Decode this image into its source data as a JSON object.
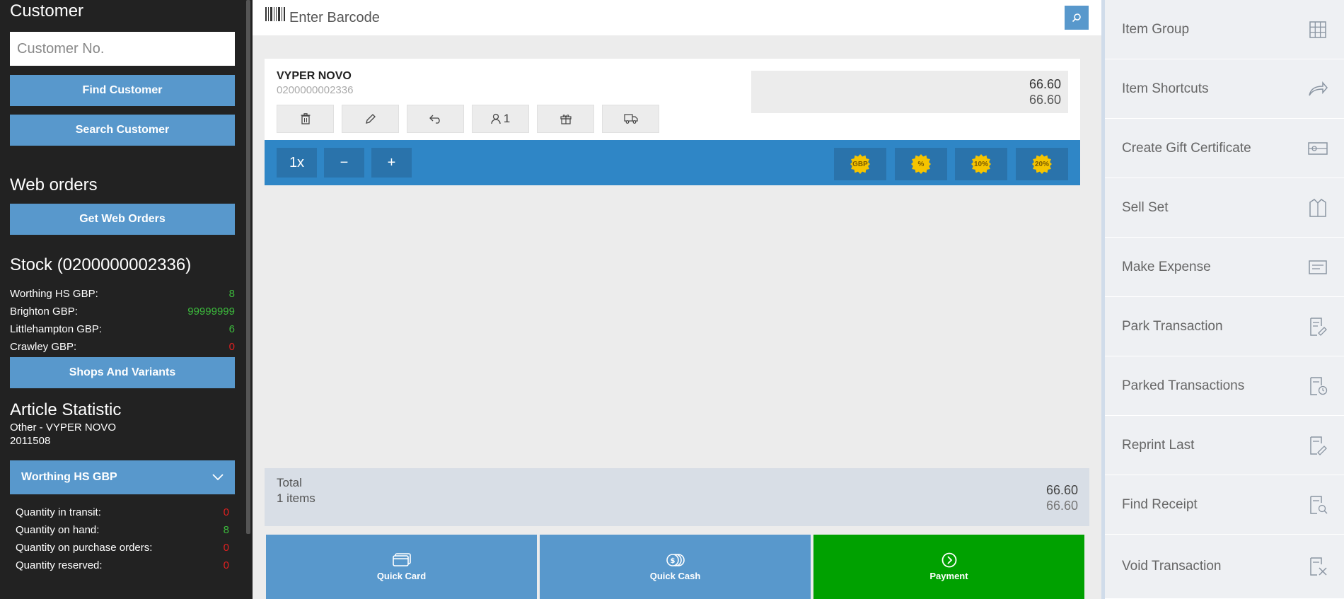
{
  "customer": {
    "title": "Customer",
    "input_placeholder": "Customer No.",
    "find_label": "Find Customer",
    "search_label": "Search Customer"
  },
  "web_orders": {
    "title": "Web orders",
    "get_label": "Get Web Orders"
  },
  "stock": {
    "title": "Stock (0200000002336)",
    "rows": [
      {
        "label": "Worthing HS GBP:",
        "value": "8",
        "status": "green"
      },
      {
        "label": "Brighton GBP:",
        "value": "99999999",
        "status": "green"
      },
      {
        "label": "Littlehampton GBP:",
        "value": "6",
        "status": "green"
      },
      {
        "label": "Crawley GBP:",
        "value": "0",
        "status": "red"
      }
    ],
    "shops_label": "Shops And Variants"
  },
  "article": {
    "title": "Article Statistic",
    "line1": "Other - VYPER NOVO",
    "line2": "2011508",
    "store_select": "Worthing HS GBP",
    "rows": [
      {
        "label": "Quantity in transit:",
        "value": "0",
        "status": "red"
      },
      {
        "label": "Quantity on hand:",
        "value": "8",
        "status": "green"
      },
      {
        "label": "Quantity on purchase orders:",
        "value": "0",
        "status": "red"
      },
      {
        "label": "Quantity reserved:",
        "value": "0",
        "status": "red"
      }
    ]
  },
  "barcode": {
    "placeholder": "Enter Barcode"
  },
  "item": {
    "name": "VYPER NOVO",
    "code": "0200000002336",
    "price": "66.60",
    "price_total": "66.60",
    "customer_count": "1"
  },
  "qty": {
    "multiplier": "1x",
    "minus": "−",
    "plus": "+"
  },
  "discounts": [
    "GBP",
    "%",
    "10%",
    "20%"
  ],
  "total": {
    "label": "Total",
    "items": "1 items",
    "value": "66.60",
    "value2": "66.60"
  },
  "actions": {
    "quick_card": "Quick Card",
    "quick_cash": "Quick Cash",
    "payment": "Payment"
  },
  "right_menu": [
    {
      "label": "Item Group",
      "icon": "grid-icon"
    },
    {
      "label": "Item Shortcuts",
      "icon": "share-arrow-icon"
    },
    {
      "label": "Create Gift Certificate",
      "icon": "gift-certificate-icon"
    },
    {
      "label": "Sell Set",
      "icon": "jacket-icon"
    },
    {
      "label": "Make Expense",
      "icon": "expense-icon"
    },
    {
      "label": "Park Transaction",
      "icon": "park-icon"
    },
    {
      "label": "Parked Transactions",
      "icon": "parked-list-icon"
    },
    {
      "label": "Reprint Last",
      "icon": "reprint-icon"
    },
    {
      "label": "Find Receipt",
      "icon": "find-receipt-icon"
    },
    {
      "label": "Void Transaction",
      "icon": "void-icon"
    }
  ],
  "colors": {
    "primary": "#5898cc",
    "qty_bar": "#2f86c6",
    "payment": "#00a100",
    "sidebar": "#222222"
  }
}
